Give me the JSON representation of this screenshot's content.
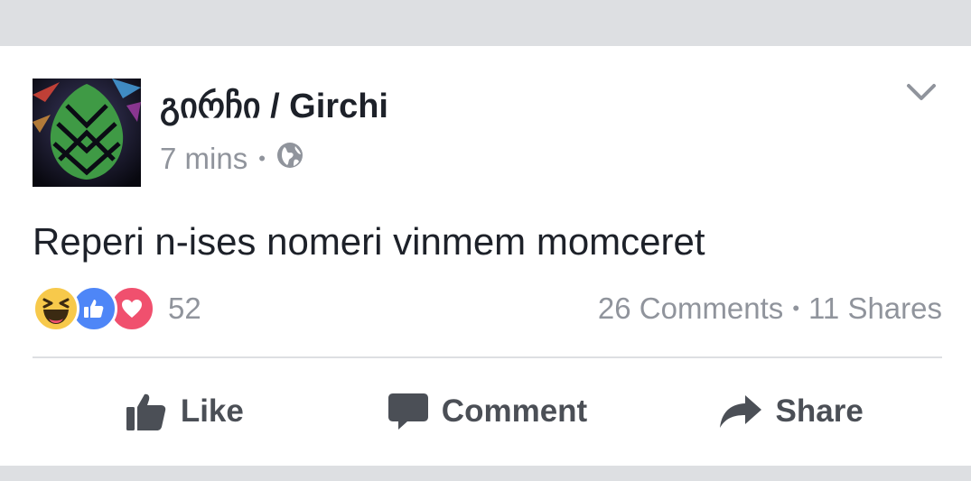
{
  "post": {
    "author": "გირჩი / Girchi",
    "time": "7 mins",
    "separator": "•",
    "privacy_icon": "globe-icon",
    "text": "Reperi n-ises nomeri vinmem momceret"
  },
  "reactions": {
    "types": [
      "haha",
      "like",
      "love"
    ],
    "count": "52"
  },
  "stats": {
    "comments": "26 Comments",
    "separator": "•",
    "shares": "11 Shares"
  },
  "actions": {
    "like": "Like",
    "comment": "Comment",
    "share": "Share"
  },
  "colors": {
    "background": "#dddfe2",
    "text": "#1d2129",
    "meta": "#90949c",
    "action": "#4b4f56",
    "like_blue": "#4e86f7",
    "love_red": "#f0506e",
    "haha_yellow": "#f7c94b"
  }
}
